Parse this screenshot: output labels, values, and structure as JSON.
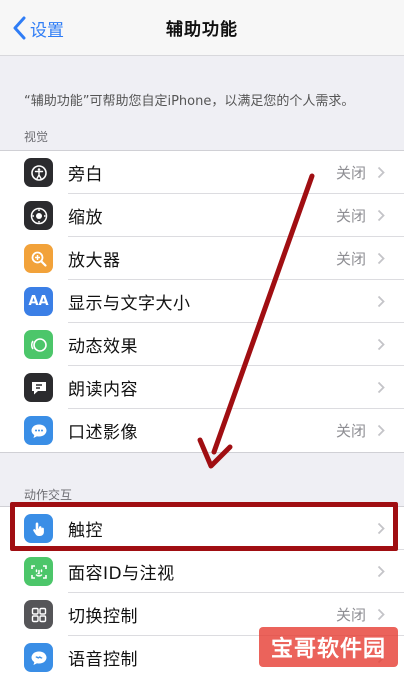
{
  "navbar": {
    "back_label": "设置",
    "title": "辅助功能"
  },
  "intro_text": "“辅助功能”可帮助您自定iPhone，以满足您的个人需求。",
  "sections": {
    "vision": {
      "header": "视觉",
      "items": [
        {
          "label": "旁白",
          "value": "关闭",
          "icon": "voiceover-icon"
        },
        {
          "label": "缩放",
          "value": "关闭",
          "icon": "zoom-icon"
        },
        {
          "label": "放大器",
          "value": "关闭",
          "icon": "magnifier-icon"
        },
        {
          "label": "显示与文字大小",
          "value": "",
          "icon": "text-size-icon"
        },
        {
          "label": "动态效果",
          "value": "",
          "icon": "motion-icon"
        },
        {
          "label": "朗读内容",
          "value": "",
          "icon": "spoken-content-icon"
        },
        {
          "label": "口述影像",
          "value": "关闭",
          "icon": "audio-description-icon"
        }
      ]
    },
    "interaction": {
      "header": "动作交互",
      "items": [
        {
          "label": "触控",
          "value": "",
          "icon": "touch-icon"
        },
        {
          "label": "面容ID与注视",
          "value": "",
          "icon": "face-id-icon"
        },
        {
          "label": "切换控制",
          "value": "关闭",
          "icon": "switch-control-icon"
        },
        {
          "label": "语音控制",
          "value": "",
          "icon": "voice-control-icon"
        }
      ]
    }
  },
  "text_size_glyph": "AA",
  "watermark_text": "宝哥软件园",
  "colors": {
    "accent": "#2f7df6",
    "highlight": "#a00e12",
    "watermark": "#e63c32"
  }
}
